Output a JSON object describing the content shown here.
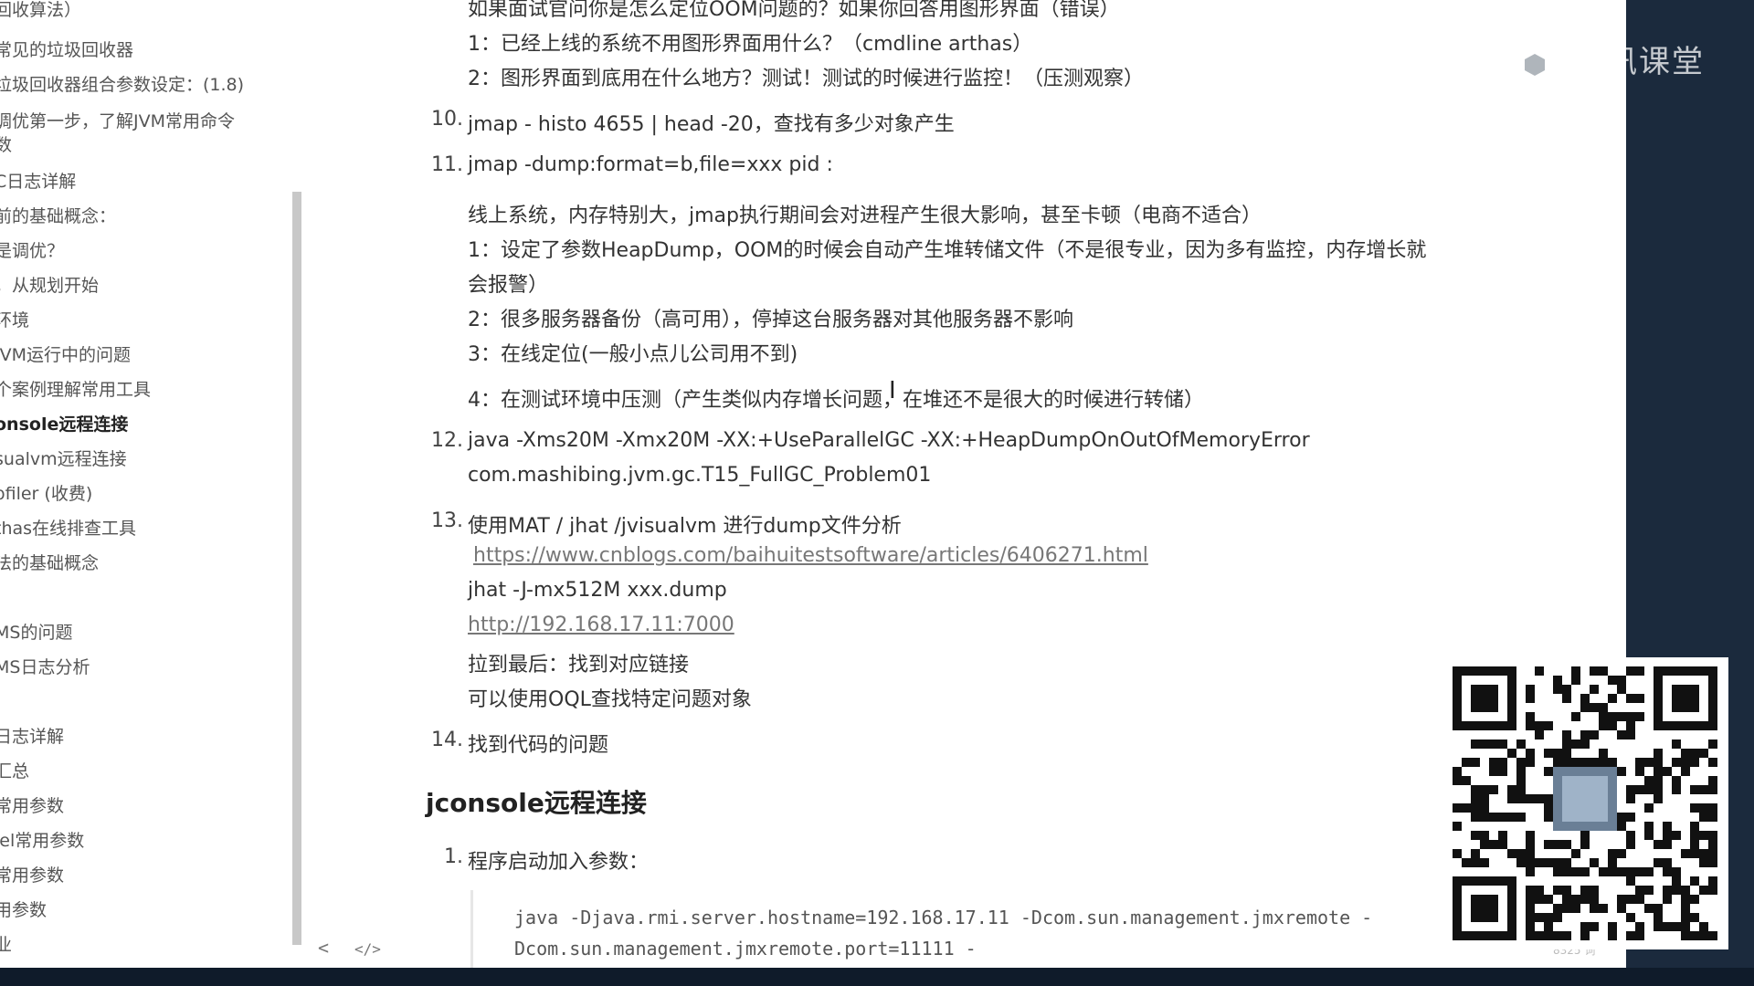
{
  "outline": {
    "items": [
      {
        "label": "回收算法）",
        "active": false
      },
      {
        "label": "常见的垃圾回收器",
        "active": false
      },
      {
        "label": "垃圾回收器组合参数设定：(1.8)",
        "active": false
      },
      {
        "label": "调优第一步，了解JVM常用命令",
        "active": false
      },
      {
        "label": "数",
        "active": false
      },
      {
        "label": "C日志详解",
        "active": false
      },
      {
        "label": "前的基础概念：",
        "active": false
      },
      {
        "label": "是调优？",
        "active": false
      },
      {
        "label": "，从规划开始",
        "active": false
      },
      {
        "label": "环境",
        "active": false
      },
      {
        "label": "JVM运行中的问题",
        "active": false
      },
      {
        "label": "个案例理解常用工具",
        "active": false
      },
      {
        "label": "onsole远程连接",
        "active": true
      },
      {
        "label": "sualvm远程连接",
        "active": false
      },
      {
        "label": "ofiler (收费)",
        "active": false
      },
      {
        "label": "thas在线排查工具",
        "active": false
      },
      {
        "label": "法的基础概念",
        "active": false
      },
      {
        "label": "MS的问题",
        "active": false
      },
      {
        "label": "MS日志分析",
        "active": false
      },
      {
        "label": "日志详解",
        "active": false
      },
      {
        "label": "汇总",
        "active": false
      },
      {
        "label": "常用参数",
        "active": false
      },
      {
        "label": "lel常用参数",
        "active": false
      },
      {
        "label": "常用参数",
        "active": false
      },
      {
        "label": "用参数",
        "active": false
      },
      {
        "label": "业",
        "active": false
      }
    ],
    "back_button": "<",
    "source_button": "</>"
  },
  "content": {
    "top_cut": "如果面试官问你是怎么定位OOM问题的？如果你回答用图形界面（错误）",
    "sub1": "1：已经上线的系统不用图形界面用什么？（cmdline arthas）",
    "sub2": "2：图形界面到底用在什么地方？测试！测试的时候进行监控！（压测观察）",
    "item10_num": "10.",
    "item10": "jmap - histo 4655 | head -20，查找有多少对象产生",
    "item11_num": "11.",
    "item11": "jmap -dump:format=b,file=xxx pid :",
    "item11_a": "线上系统，内存特别大，jmap执行期间会对进程产生很大影响，甚至卡顿（电商不适合）",
    "item11_b": "1：设定了参数HeapDump，OOM的时候会自动产生堆转储文件（不是很专业，因为多有监控，内存增长就",
    "item11_b2": "会报警）",
    "item11_c": "2：很多服务器备份（高可用），停掉这台服务器对其他服务器不影响",
    "item11_d": "3：在线定位(一般小点儿公司用不到)",
    "item11_e": "4：在测试环境中压测（产生类似内存增长问题，在堆还不是很大的时候进行转储）",
    "item12_num": "12.",
    "item12": "java -Xms20M -Xmx20M -XX:+UseParallelGC -XX:+HeapDumpOnOutOfMemoryError",
    "item12_b": "com.mashibing.jvm.gc.T15_FullGC_Problem01",
    "item13_num": "13.",
    "item13": "使用MAT / jhat /jvisualvm 进行dump文件分析",
    "item13_link": "https://www.cnblogs.com/baihuitestsoftware/articles/6406271.html",
    "item13_b": "jhat -J-mx512M xxx.dump",
    "item13_link2": "http://192.168.17.11:7000",
    "item13_c": "拉到最后：找到对应链接",
    "item13_d": "可以使用OQL查找特定问题对象",
    "item14_num": "14.",
    "item14": "找到代码的问题",
    "heading": "jconsole远程连接",
    "list1_num": "1.",
    "list1": "程序启动加入参数：",
    "code1": "java -Djava.rmi.server.hostname=192.168.17.11 -Dcom.sun.management.jmxremote -",
    "code2": "Dcom.sun.management.jmxremote.port=11111 -"
  },
  "overlay": {
    "watermark": "腾讯课堂",
    "status_small": "8325 词"
  },
  "colors": {
    "background": "#1b2a3d",
    "page": "#ffffff",
    "text": "#333333",
    "link": "#777777"
  }
}
